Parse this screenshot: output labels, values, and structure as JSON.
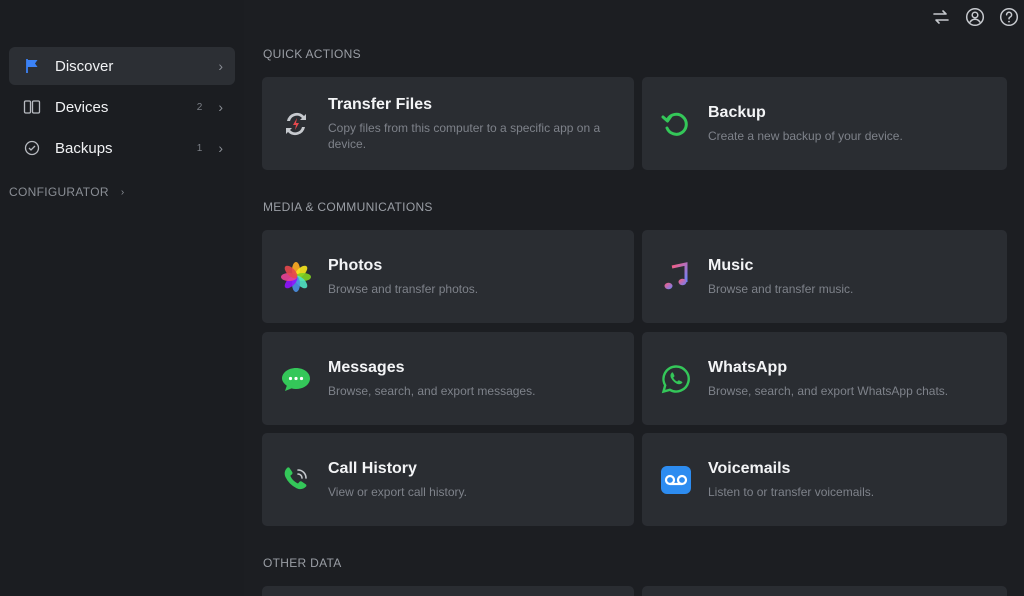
{
  "sidebar": {
    "items": [
      {
        "label": "Discover",
        "count": "",
        "icon": "flag-icon"
      },
      {
        "label": "Devices",
        "count": "2",
        "icon": "devices-icon"
      },
      {
        "label": "Backups",
        "count": "1",
        "icon": "backup-clock-icon"
      }
    ],
    "configurator": "CONFIGURATOR"
  },
  "sections": {
    "quick_actions": "QUICK ACTIONS",
    "media": "MEDIA & COMMUNICATIONS",
    "other": "OTHER DATA"
  },
  "cards": {
    "transfer": {
      "title": "Transfer Files",
      "desc": "Copy files from this computer to a specific app on a device."
    },
    "backup": {
      "title": "Backup",
      "desc": "Create a new backup of your device."
    },
    "photos": {
      "title": "Photos",
      "desc": "Browse and transfer photos."
    },
    "music": {
      "title": "Music",
      "desc": "Browse and transfer music."
    },
    "messages": {
      "title": "Messages",
      "desc": "Browse, search, and export messages."
    },
    "whatsapp": {
      "title": "WhatsApp",
      "desc": "Browse, search, and export WhatsApp chats."
    },
    "calls": {
      "title": "Call History",
      "desc": "View or export call history."
    },
    "voicemails": {
      "title": "Voicemails",
      "desc": "Listen to or transfer voicemails."
    }
  },
  "colors": {
    "accent_blue": "#3b82f6",
    "green": "#34c759",
    "card_bg": "#2a2d32"
  }
}
